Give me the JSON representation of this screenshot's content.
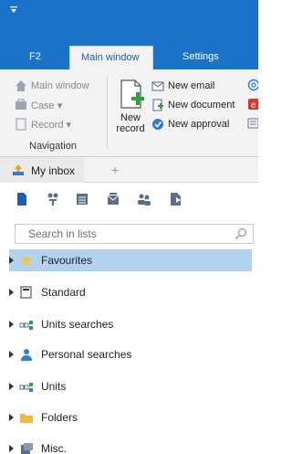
{
  "header": {
    "tabs": [
      {
        "label": "F2"
      },
      {
        "label": "Main window"
      },
      {
        "label": "Settings"
      }
    ]
  },
  "ribbon": {
    "navigation": {
      "items": [
        {
          "label": "Main window",
          "icon": "home-icon"
        },
        {
          "label": "Case ▾",
          "icon": "case-icon"
        },
        {
          "label": "Record ▾",
          "icon": "record-icon"
        }
      ],
      "group_label": "Navigation"
    },
    "new_record": {
      "label": "New record",
      "icon": "new-record-icon"
    },
    "new_items": [
      {
        "label": "New email",
        "icon": "email-icon"
      },
      {
        "label": "New document",
        "icon": "document-icon"
      },
      {
        "label": "New approval",
        "icon": "approval-icon"
      }
    ]
  },
  "inbox": {
    "tab_label": "My inbox",
    "add_tab": "+"
  },
  "toolbar": {
    "icons": [
      "new-document-icon",
      "org-tree-icon",
      "list-icon",
      "mail-stack-icon",
      "people-icon",
      "file-icon"
    ]
  },
  "search": {
    "placeholder": "Search in lists"
  },
  "tree": {
    "items": [
      {
        "label": "Favourites",
        "icon": "star-icon",
        "selected": true
      },
      {
        "label": "Standard",
        "icon": "list-box-icon",
        "selected": false
      },
      {
        "label": "Units searches",
        "icon": "units-icon",
        "selected": false
      },
      {
        "label": "Personal searches",
        "icon": "person-icon",
        "selected": false
      },
      {
        "label": "Units",
        "icon": "units-icon",
        "selected": false
      },
      {
        "label": "Folders",
        "icon": "folder-icon",
        "selected": false
      },
      {
        "label": "Misc.",
        "icon": "misc-icon",
        "selected": false
      }
    ]
  },
  "colors": {
    "accent": "#1a73c9",
    "selection": "#b3d2f0",
    "ribbon_bg": "#f3f3f3"
  }
}
